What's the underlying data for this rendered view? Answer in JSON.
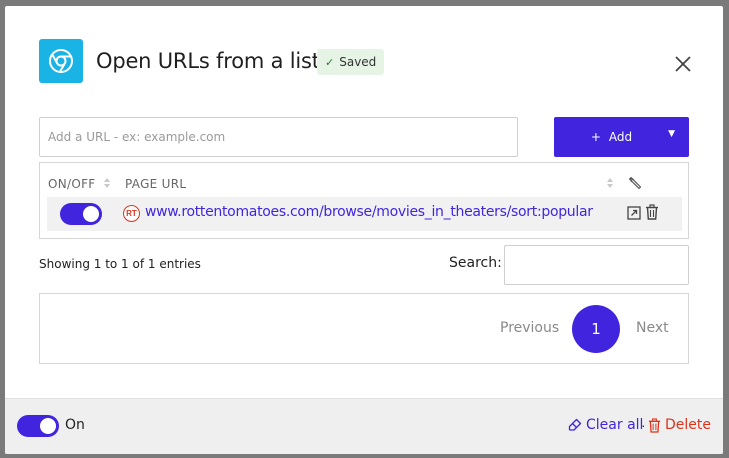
{
  "header": {
    "title": "Open URLs from a list",
    "saved_badge": "Saved",
    "app_icon": "chrome-icon",
    "close_icon": "close-icon"
  },
  "url_entry": {
    "placeholder": "Add a URL - ex: example.com",
    "value": "",
    "add_label": "Add",
    "add_plus": "+",
    "add_dropdown_icon": "caret-down-icon"
  },
  "table": {
    "columns": [
      "ON/OFF",
      "PAGE URL"
    ],
    "rows": [
      {
        "enabled": true,
        "favicon": "RT",
        "url": "www.rottentomatoes.com/browse/movies_in_theaters/sort:popular"
      }
    ]
  },
  "info": {
    "showing": "Showing 1 to 1 of 1 entries",
    "search_label": "Search:",
    "search_value": ""
  },
  "pagination": {
    "previous": "Previous",
    "current_page": "1",
    "next": "Next"
  },
  "footer": {
    "toggle_on": true,
    "on_label": "On",
    "clear_all": "Clear all",
    "separator": "·",
    "delete": "Delete"
  },
  "colors": {
    "accent": "#4125de",
    "app_icon_bg": "#1ab3e6",
    "delete_red": "#d9341e",
    "saved_badge_bg": "#e6f4e6"
  }
}
